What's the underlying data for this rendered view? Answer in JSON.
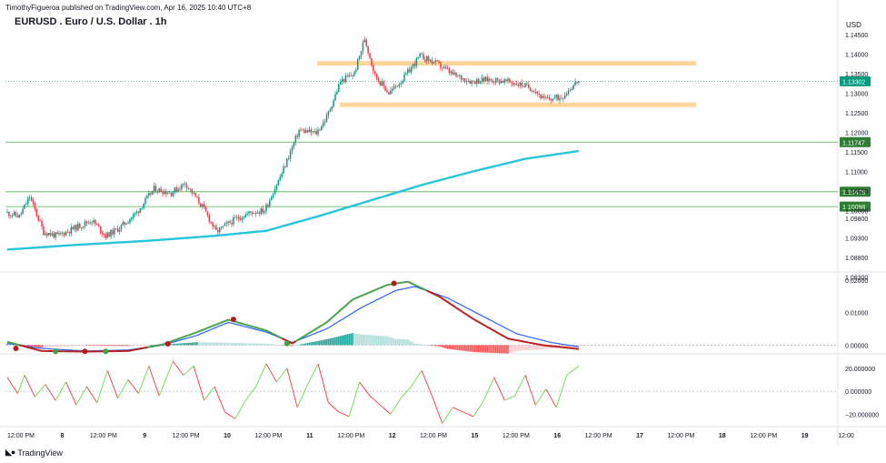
{
  "header": {
    "publisher": "TimothyFigueroa published on TradingView.com, Apr 16, 2025 10:40 UTC+8",
    "symbol_title": "EURUSD . Euro / U.S. Dollar . 1h",
    "currency": "USD"
  },
  "footer": {
    "brand": "TradingView",
    "brand_icon": "tradingview-logo-icon"
  },
  "colors": {
    "up": "#089981",
    "down": "#f23645",
    "ema": "#26c6da",
    "zone": "#ffd59a",
    "level_line": "#4caf50",
    "level_label": "#2e7d32",
    "price_label": "#089981",
    "macd": "#2962ff",
    "macd_green": "#43a047",
    "macd_red": "#b71c1c"
  },
  "chart_data": [
    {
      "type": "candlestick",
      "title": "EURUSD . Euro / U.S. Dollar . 1h",
      "ylim": [
        1.0845,
        1.148
      ],
      "y_ticks": [
        "1.14500",
        "1.14000",
        "1.13500",
        "1.13000",
        "1.12500",
        "1.12000",
        "1.11500",
        "1.11000",
        "1.10500",
        "1.10000",
        "1.09800",
        "1.09300",
        "1.08800",
        "1.08300"
      ],
      "x_ticks": [
        "12:00 PM",
        "8",
        "12:00 PM",
        "9",
        "12:00 PM",
        "10",
        "12:00 PM",
        "11",
        "12:00 PM",
        "12",
        "12:00 PM",
        "15",
        "12:00 PM",
        "16",
        "12:00 PM",
        "17",
        "12:00 PM",
        "18",
        "12:00 PM",
        "19",
        "12:00"
      ],
      "x_tick_bold": [
        false,
        true,
        false,
        true,
        false,
        true,
        false,
        true,
        false,
        true,
        false,
        true,
        false,
        true,
        false,
        true,
        false,
        true,
        false,
        true,
        false
      ],
      "current_price": 1.13302,
      "price_labels": [
        "1.13302"
      ],
      "horizontal_levels": [
        1.11747,
        1.10478,
        1.10098
      ],
      "level_labels": [
        "1.11747",
        "1.10478",
        "1.10098"
      ],
      "resistance_zone": [
        1.1375,
        1.1382
      ],
      "support_zone": [
        1.1269,
        1.1276
      ],
      "anchors": [
        [
          0,
          1.0995
        ],
        [
          8,
          1.0985
        ],
        [
          14,
          1.1035
        ],
        [
          22,
          1.0945
        ],
        [
          30,
          1.0935
        ],
        [
          40,
          1.0955
        ],
        [
          50,
          1.0975
        ],
        [
          58,
          1.0935
        ],
        [
          66,
          1.0955
        ],
        [
          76,
          1.0995
        ],
        [
          86,
          1.1055
        ],
        [
          96,
          1.1045
        ],
        [
          104,
          1.107
        ],
        [
          114,
          1.101
        ],
        [
          122,
          1.0945
        ],
        [
          132,
          1.0975
        ],
        [
          142,
          1.0995
        ],
        [
          150,
          1.1
        ],
        [
          160,
          1.1095
        ],
        [
          170,
          1.1205
        ],
        [
          180,
          1.1198
        ],
        [
          186,
          1.1238
        ],
        [
          194,
          1.133
        ],
        [
          202,
          1.135
        ],
        [
          208,
          1.144
        ],
        [
          214,
          1.1345
        ],
        [
          222,
          1.13
        ],
        [
          230,
          1.1335
        ],
        [
          240,
          1.1395
        ],
        [
          250,
          1.1375
        ],
        [
          260,
          1.1345
        ],
        [
          270,
          1.133
        ],
        [
          280,
          1.1335
        ],
        [
          290,
          1.133
        ],
        [
          300,
          1.132
        ],
        [
          306,
          1.131
        ],
        [
          312,
          1.1283
        ],
        [
          322,
          1.129
        ],
        [
          331,
          1.133
        ]
      ],
      "ema": [
        [
          0,
          1.09
        ],
        [
          40,
          1.0912
        ],
        [
          80,
          1.0922
        ],
        [
          120,
          1.0935
        ],
        [
          150,
          1.0948
        ],
        [
          180,
          1.0985
        ],
        [
          210,
          1.1025
        ],
        [
          240,
          1.1065
        ],
        [
          270,
          1.11
        ],
        [
          300,
          1.1132
        ],
        [
          331,
          1.1152
        ]
      ],
      "ema_name": "",
      "bars": 332
    },
    {
      "type": "line",
      "title": "",
      "ylim": [
        -0.0024,
        0.0222
      ],
      "y_ticks": [
        "0.02000",
        "0.01000",
        "0.00000"
      ],
      "macd_line": [
        [
          0,
          0.001
        ],
        [
          20,
          -0.0018
        ],
        [
          45,
          -0.002
        ],
        [
          70,
          -0.0018
        ],
        [
          90,
          0.0002
        ],
        [
          110,
          0.004
        ],
        [
          128,
          0.0078
        ],
        [
          150,
          0.0045
        ],
        [
          165,
          0.0005
        ],
        [
          185,
          0.007
        ],
        [
          200,
          0.014
        ],
        [
          220,
          0.0185
        ],
        [
          232,
          0.0195
        ],
        [
          250,
          0.015
        ],
        [
          270,
          0.008
        ],
        [
          290,
          0.002
        ],
        [
          310,
          0.0
        ],
        [
          331,
          -0.0012
        ]
      ],
      "signal_line": [
        [
          0,
          0.0005
        ],
        [
          20,
          -0.001
        ],
        [
          45,
          -0.0018
        ],
        [
          70,
          -0.0015
        ],
        [
          90,
          0.0
        ],
        [
          110,
          0.003
        ],
        [
          128,
          0.007
        ],
        [
          150,
          0.004
        ],
        [
          165,
          0.0008
        ],
        [
          185,
          0.005
        ],
        [
          205,
          0.0115
        ],
        [
          225,
          0.0168
        ],
        [
          236,
          0.018
        ],
        [
          255,
          0.0145
        ],
        [
          275,
          0.009
        ],
        [
          295,
          0.0035
        ],
        [
          315,
          0.0008
        ],
        [
          331,
          -0.0005
        ]
      ],
      "crossovers": [
        {
          "x": 5,
          "v": -0.001,
          "kind": "bearish"
        },
        {
          "x": 28,
          "v": -0.0019,
          "kind": "bullish"
        },
        {
          "x": 45,
          "v": -0.0019,
          "kind": "bearish"
        },
        {
          "x": 57,
          "v": -0.0019,
          "kind": "bullish"
        },
        {
          "x": 93,
          "v": 0.0004,
          "kind": "bearish"
        },
        {
          "x": 131,
          "v": 0.0079,
          "kind": "bearish"
        },
        {
          "x": 162,
          "v": 0.0005,
          "kind": "bullish"
        },
        {
          "x": 224,
          "v": 0.019,
          "kind": "bearish"
        }
      ]
    },
    {
      "type": "line",
      "title": "",
      "ylim": [
        -30,
        31
      ],
      "y_ticks": [
        "20.000000",
        "0.000000",
        "−20.000000"
      ],
      "zero_line": 0,
      "osc": [
        [
          0,
          12
        ],
        [
          6,
          -2
        ],
        [
          10,
          14
        ],
        [
          16,
          -5
        ],
        [
          22,
          6
        ],
        [
          28,
          -8
        ],
        [
          34,
          8
        ],
        [
          40,
          -12
        ],
        [
          46,
          4
        ],
        [
          52,
          -10
        ],
        [
          58,
          18
        ],
        [
          64,
          -6
        ],
        [
          70,
          10
        ],
        [
          76,
          -2
        ],
        [
          82,
          22
        ],
        [
          88,
          -4
        ],
        [
          96,
          26
        ],
        [
          102,
          14
        ],
        [
          108,
          22
        ],
        [
          114,
          -8
        ],
        [
          120,
          4
        ],
        [
          126,
          -18
        ],
        [
          132,
          -24
        ],
        [
          138,
          -8
        ],
        [
          144,
          4
        ],
        [
          150,
          24
        ],
        [
          156,
          8
        ],
        [
          162,
          20
        ],
        [
          168,
          -14
        ],
        [
          174,
          6
        ],
        [
          180,
          24
        ],
        [
          186,
          -10
        ],
        [
          192,
          -18
        ],
        [
          198,
          -22
        ],
        [
          204,
          8
        ],
        [
          210,
          -4
        ],
        [
          216,
          -12
        ],
        [
          222,
          -20
        ],
        [
          228,
          -6
        ],
        [
          234,
          4
        ],
        [
          240,
          18
        ],
        [
          246,
          -4
        ],
        [
          252,
          -28
        ],
        [
          258,
          -14
        ],
        [
          264,
          -18
        ],
        [
          270,
          -22
        ],
        [
          276,
          -8
        ],
        [
          282,
          12
        ],
        [
          288,
          -8
        ],
        [
          294,
          -4
        ],
        [
          300,
          14
        ],
        [
          306,
          -12
        ],
        [
          312,
          2
        ],
        [
          318,
          -14
        ],
        [
          324,
          14
        ],
        [
          331,
          22
        ]
      ]
    }
  ]
}
